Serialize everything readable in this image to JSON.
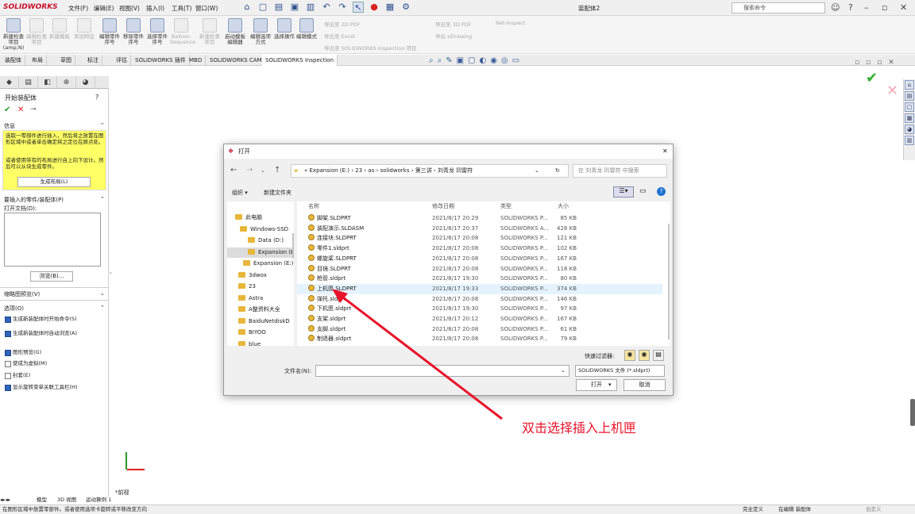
{
  "app": {
    "logo": "SOLIDWORKS",
    "window_title": "装配体2",
    "menus": [
      "文件(F)",
      "编辑(E)",
      "视图(V)",
      "插入(I)",
      "工具(T)",
      "窗口(W)"
    ],
    "search_placeholder": "搜索命令"
  },
  "ribbon": {
    "buttons": [
      "新建检查项目(amp;N)",
      "编辑检查项目",
      "新建模板",
      "添加特征",
      "编辑零件序号",
      "移除零件序号",
      "选择零件序号",
      "Balloon Sequence",
      "新建检查项目",
      "启动模板编辑器",
      "编辑选项方式",
      "选择操作",
      "编辑模式"
    ],
    "export_items": [
      "导出至 2D PDF",
      "导出至 Excel",
      "导出至 SOLIDWORKS Inspection 项目",
      "导出至 3D PDF",
      "导出 eDrawing",
      "Net-Inspect"
    ]
  },
  "cmd_tabs": [
    "装配体",
    "布局",
    "草图",
    "标注",
    "评估",
    "SOLIDWORKS 插件",
    "MBD",
    "SOLIDWORKS CAM",
    "SOLIDWORKS Inspection"
  ],
  "left_panel": {
    "title": "开始装配体",
    "message_header": "信息",
    "message_text1": "选取一零部件进行插入，然后将之放置在图形区域中或者单击确定将之定位在原点处。",
    "message_text2": "或者使用带有的布局进行自上向下设计。然后可以从块生成零件。",
    "create_layout_btn": "生成布局(L)",
    "insert_header": "要插入的零件/装配体(P)",
    "open_docs_label": "打开文档(D):",
    "browse_btn": "浏览(B)...",
    "thumbnail_label": "缩略图预览(V)",
    "options_header": "选项(O)",
    "options": [
      {
        "label": "生成新装配体时开始命令(S)",
        "checked": true
      },
      {
        "label": "生成新装配体时自动浏览(A)",
        "checked": true
      },
      {
        "label": "图形预览(G)",
        "checked": true
      },
      {
        "label": "使成为虚拟(M)",
        "checked": false
      },
      {
        "label": "封套(E)",
        "checked": false
      },
      {
        "label": "显示旋转菜单关联工具栏(H)",
        "checked": true
      }
    ]
  },
  "dialog": {
    "title": "打开",
    "path": "« Expansion (E:) › 23 › as › solidworks › 第三讲 › 刘青龙 凹雷符",
    "search_placeholder": "在 刘青龙 凹雷符 中搜索",
    "organize": "组织 ▾",
    "new_folder": "新建文件夹",
    "nav_items": [
      {
        "label": "此电脑",
        "sel": false
      },
      {
        "label": "Windows-SSD",
        "sel": false
      },
      {
        "label": "Data (D:)",
        "sel": false
      },
      {
        "label": "Expansion (E:)",
        "sel": true
      },
      {
        "label": "Expansion (E:)",
        "sel": false
      },
      {
        "label": "3dwox",
        "sel": false
      },
      {
        "label": "23",
        "sel": false
      },
      {
        "label": "Astra",
        "sel": false
      },
      {
        "label": "A整资料大全",
        "sel": false
      },
      {
        "label": "BaiduNetdiskD",
        "sel": false
      },
      {
        "label": "BIYOO",
        "sel": false
      },
      {
        "label": "blue",
        "sel": false
      }
    ],
    "columns": [
      "名称",
      "修改日期",
      "类型",
      "大小"
    ],
    "files": [
      {
        "name": "脚架.SLDPRT",
        "date": "2021/8/17 20:29",
        "type": "SOLIDWORKS P...",
        "size": "85 KB"
      },
      {
        "name": "装配演示.SLDASM",
        "date": "2021/8/17 20:37",
        "type": "SOLIDWORKS A...",
        "size": "428 KB"
      },
      {
        "name": "连接块.SLDPRT",
        "date": "2021/8/17 20:08",
        "type": "SOLIDWORKS P...",
        "size": "121 KB"
      },
      {
        "name": "零件1.sldprt",
        "date": "2021/8/17 20:08",
        "type": "SOLIDWORKS P...",
        "size": "102 KB"
      },
      {
        "name": "螺旋桨.SLDPRT",
        "date": "2021/8/17 20:08",
        "type": "SOLIDWORKS P...",
        "size": "167 KB"
      },
      {
        "name": "目镜.SLDPRT",
        "date": "2021/8/17 20:08",
        "type": "SOLIDWORKS P...",
        "size": "118 KB"
      },
      {
        "name": "枪管.sldprt",
        "date": "2021/8/17 19:30",
        "type": "SOLIDWORKS P...",
        "size": "80 KB"
      },
      {
        "name": "上机匣.SLDPRT",
        "date": "2021/8/17 19:33",
        "type": "SOLIDWORKS P...",
        "size": "374 KB"
      },
      {
        "name": "弹托.sldprt",
        "date": "2021/8/17 20:08",
        "type": "SOLIDWORKS P...",
        "size": "146 KB"
      },
      {
        "name": "下机匣.sldprt",
        "date": "2021/8/17 19:30",
        "type": "SOLIDWORKS P...",
        "size": "97 KB"
      },
      {
        "name": "支架.sldprt",
        "date": "2021/8/17 20:12",
        "type": "SOLIDWORKS P...",
        "size": "167 KB"
      },
      {
        "name": "支脚.sldprt",
        "date": "2021/8/17 20:08",
        "type": "SOLIDWORKS P...",
        "size": "61 KB"
      },
      {
        "name": "制退器.sldprt",
        "date": "2021/8/17 20:08",
        "type": "SOLIDWORKS P...",
        "size": "79 KB"
      }
    ],
    "quick_filter": "快速过滤器:",
    "filename_label": "文件名(N):",
    "filetype": "SOLIDWORKS 文件 (*.sldprt)",
    "open_btn": "打开",
    "cancel_btn": "取消"
  },
  "annotation": "双击选择插入上机匣",
  "view_label": "*前视",
  "bottom_tabs": [
    "模型",
    "3D 视图",
    "运动算例 1"
  ],
  "status": {
    "hint": "在图形区域中放置零部件。或者使用选项卡旋转或平移改变方向",
    "state": "完全定义",
    "editing": "在编辑 装配体",
    "custom": "自定义"
  },
  "colors": {
    "accent": "#e8142b",
    "check": "#2db02d",
    "selection": "#e5f3ff",
    "note_bg": "#ffff66"
  }
}
